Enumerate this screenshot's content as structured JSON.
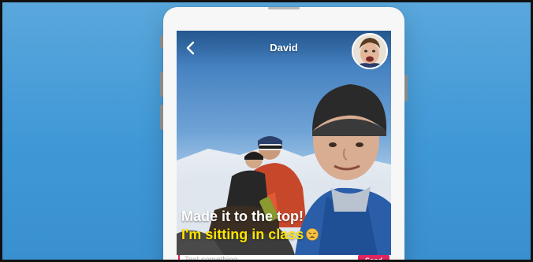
{
  "colors": {
    "background_top": "#5aa7dc",
    "background_bottom": "#3a90cf",
    "phone_body": "#f7f7f7",
    "caption_primary": "#ffffff",
    "caption_secondary": "#ffe400",
    "send_accent": "#e0245e"
  },
  "header": {
    "back_icon": "chevron-left-icon",
    "title": "David",
    "avatar_icon": "contact-avatar"
  },
  "message": {
    "caption": "Made it to the top!",
    "reply": "I'm sitting in class",
    "reply_emoji": "weary-face-emoji"
  },
  "compose": {
    "placeholder": "Text something",
    "send_label": "Send"
  }
}
